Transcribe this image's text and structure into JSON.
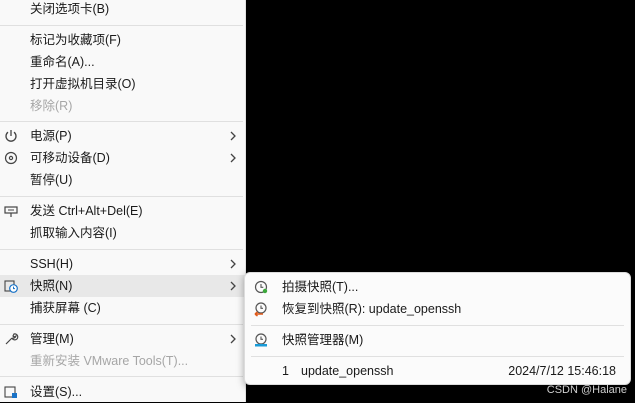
{
  "menu": {
    "items": [
      {
        "label": "关闭选项卡(B)"
      },
      {
        "label": "标记为收藏项(F)"
      },
      {
        "label": "重命名(A)..."
      },
      {
        "label": "打开虚拟机目录(O)"
      },
      {
        "label": "移除(R)"
      },
      {
        "label": "电源(P)"
      },
      {
        "label": "可移动设备(D)"
      },
      {
        "label": "暂停(U)"
      },
      {
        "label": "发送 Ctrl+Alt+Del(E)"
      },
      {
        "label": "抓取输入内容(I)"
      },
      {
        "label": "SSH(H)"
      },
      {
        "label": "快照(N)"
      },
      {
        "label": "捕获屏幕 (C)"
      },
      {
        "label": "管理(M)"
      },
      {
        "label": "重新安装 VMware Tools(T)..."
      },
      {
        "label": "设置(S)..."
      }
    ]
  },
  "snapshot_menu": {
    "take": "拍摄快照(T)...",
    "revert": "恢复到快照(R): update_openssh",
    "manager": "快照管理器(M)",
    "entry": {
      "index": "1",
      "name": "update_openssh",
      "date": "2024/7/12 15:46:18"
    }
  },
  "watermark": "CSDN @Halane",
  "colors": {
    "accent": "#1a73c7",
    "disabled": "#a6a6a6",
    "menu_bg": "#f9f9f9"
  }
}
